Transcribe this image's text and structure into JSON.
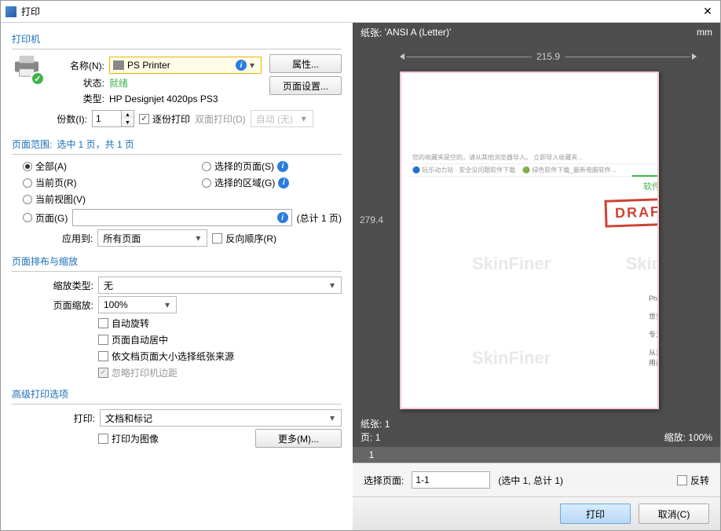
{
  "title": "打印",
  "printer": {
    "section_label": "打印机",
    "name_label": "名称(N):",
    "name_value": "PS Printer",
    "properties_btn": "属性...",
    "page_setup_btn": "页面设置...",
    "status_label": "状态:",
    "status_value": "就绪",
    "type_label": "类型:",
    "type_value": "HP Designjet 4020ps PS3",
    "copies_label": "份数(I):",
    "copies_value": "1",
    "collate_label": "逐份打印",
    "duplex_label": "双面打印(D)",
    "duplex_value": "自动 (无)"
  },
  "range": {
    "section_label": "页面范围:",
    "section_extra": "选中 1 页，共 1 页",
    "all": "全部(A)",
    "current_page": "当前页(R)",
    "current_view": "当前视图(V)",
    "pages": "页面(G)",
    "selected_pages": "选择的页面(S)",
    "selected_graphics": "选择的区域(G)",
    "pages_total": "(总计 1 页)",
    "apply_to_label": "应用到:",
    "apply_to_value": "所有页面",
    "reverse_label": "反向顺序(R)"
  },
  "layout": {
    "section_label": "页面排布与缩放",
    "scale_type_label": "缩放类型:",
    "scale_type_value": "无",
    "page_scale_label": "页面缩放:",
    "page_scale_value": "100%",
    "auto_rotate": "自动旋转",
    "auto_center": "页面自动居中",
    "choose_source": "依文档页面大小选择纸张来源",
    "ignore_margins": "忽略打印机边距"
  },
  "advanced": {
    "section_label": "高级打印选项",
    "print_label": "打印:",
    "print_value": "文档和标记",
    "as_image": "打印为图像",
    "more_btn": "更多(M)..."
  },
  "preview": {
    "paper_label": "纸张:",
    "paper_value": "'ANSI A (Letter)'",
    "unit": "mm",
    "width": "215.9",
    "height": "279.4",
    "sheets_label": "纸张:",
    "sheets_value": "1",
    "page_label": "页:",
    "page_value": "1",
    "zoom_label": "缩放:",
    "zoom_value": "100%",
    "page_tab": "1",
    "draft": "DRAFT",
    "watermark": "SkinFiner",
    "green_tab": "软件介绍",
    "select_pages_label": "选择页面:",
    "select_pages_value": "1-1",
    "select_pages_info": "(选中 1, 总计 1)",
    "reverse": "反转"
  },
  "footer": {
    "print_btn": "打印",
    "cancel_btn": "取消(C)"
  }
}
